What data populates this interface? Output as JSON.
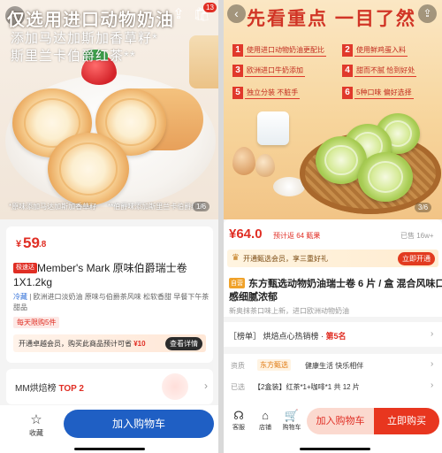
{
  "left": {
    "hero": {
      "title_line1": "仅选用进口动物奶油",
      "title_line2": "添加马达加斯加香草籽*",
      "title_line3": "斯里兰卡伯爵红茶**",
      "caption_left": "*原味添加马达加斯加香草籽",
      "caption_right": "**伯爵味添加斯里兰卡伯爵红茶",
      "cart_badge": "13",
      "pager": "1/6"
    },
    "price": {
      "symbol": "¥",
      "integer": "59",
      "decimal": ".8"
    },
    "tag_fast": "极速达",
    "name_line1": "Member's Mark 原味伯爵瑞士卷",
    "name_line2": "1X1.2kg",
    "attr_cold": "冷藏",
    "attr_rest": " | 欧洲进口淡奶油  原味与伯爵茶风味  松软香甜  早餐下午茶",
    "attr_line2": "甜品",
    "limit_tag": "每天限购5件",
    "member_text_prefix": "开通卓越会员，购买此商品预计可省 ",
    "member_saving": "¥10",
    "member_button": "查看详情",
    "rank_prefix": "MM烘焙榜 ",
    "rank_value": "TOP 2",
    "bottom": {
      "fav_label": "收藏",
      "add_cart": "加入购物车"
    }
  },
  "right": {
    "hero": {
      "title": "先看重点 一目了然",
      "features": [
        {
          "num": "1",
          "text": "使用进口动物奶油更配比"
        },
        {
          "num": "2",
          "text": "使用鲜鸡蛋入料"
        },
        {
          "num": "3",
          "text": "欧洲进口牛奶添加"
        },
        {
          "num": "4",
          "text": "甜而不腻 恰到好处"
        },
        {
          "num": "5",
          "text": "独立分装 不脏手"
        },
        {
          "num": "6",
          "text": "5种口味 偏好选择"
        }
      ],
      "pager": "3/6"
    },
    "price": "¥64.0",
    "price_note": "预计返 64 甄果",
    "sold": "已售 16w+",
    "member_text": "开通甄选会员，享三重好礼",
    "member_button": "立即开通",
    "self_tag": "自营",
    "name_line1": "东方甄选动物奶油瑞士卷 6 片 / 盒 混合风味口",
    "name_line2": "感细腻浓郁",
    "subtitle": "新奥抹茶口味上新，进口欧洲动物奶油",
    "rank_prefix": "［榜单］ 烘焙点心热销榜 · ",
    "rank_value": "第5名",
    "qual_label": "资质",
    "qual_badge": "东方甄选",
    "qual_text": "健康生活 快乐相伴",
    "selected_label": "已选",
    "selected_text": "【2盒装】红茶*1+咖啡*1 共 12 片",
    "bottom": {
      "service": "客服",
      "shop": "店铺",
      "cart": "购物车",
      "add_cart": "加入购物车",
      "buy_now": "立即购买"
    }
  }
}
